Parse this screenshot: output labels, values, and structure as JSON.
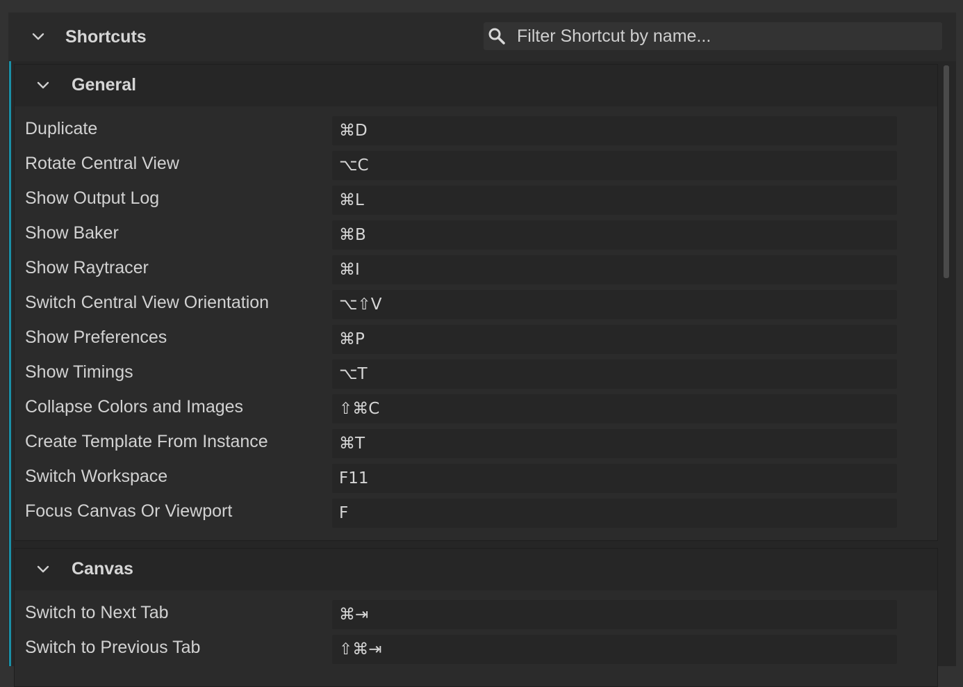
{
  "panel": {
    "title": "Shortcuts",
    "collapse_icon": "chevron-down-icon",
    "search": {
      "icon": "search-icon",
      "placeholder": "Filter Shortcut by name...",
      "value": ""
    }
  },
  "colors": {
    "accent": "#1a8fa6",
    "background": "#262626",
    "section_bg": "#2b2b2b",
    "key_field_bg": "#262626",
    "text": "#d2d2d2"
  },
  "sections": [
    {
      "title": "General",
      "rows": [
        {
          "name": "Duplicate",
          "key": "⌘D"
        },
        {
          "name": "Rotate Central View",
          "key": "⌥C"
        },
        {
          "name": "Show Output Log",
          "key": "⌘L"
        },
        {
          "name": "Show Baker",
          "key": "⌘B"
        },
        {
          "name": "Show Raytracer",
          "key": "⌘I"
        },
        {
          "name": "Switch Central View Orientation",
          "key": "⌥⇧V"
        },
        {
          "name": "Show Preferences",
          "key": "⌘P"
        },
        {
          "name": "Show Timings",
          "key": "⌥T"
        },
        {
          "name": "Collapse Colors and Images",
          "key": "⇧⌘C"
        },
        {
          "name": "Create Template From Instance",
          "key": "⌘T"
        },
        {
          "name": "Switch Workspace",
          "key": "F11"
        },
        {
          "name": "Focus Canvas Or Viewport",
          "key": "F"
        }
      ]
    },
    {
      "title": "Canvas",
      "rows": [
        {
          "name": "Switch to Next Tab",
          "key": "⌘⇥"
        },
        {
          "name": "Switch to Previous Tab",
          "key": "⇧⌘⇥"
        }
      ]
    }
  ]
}
